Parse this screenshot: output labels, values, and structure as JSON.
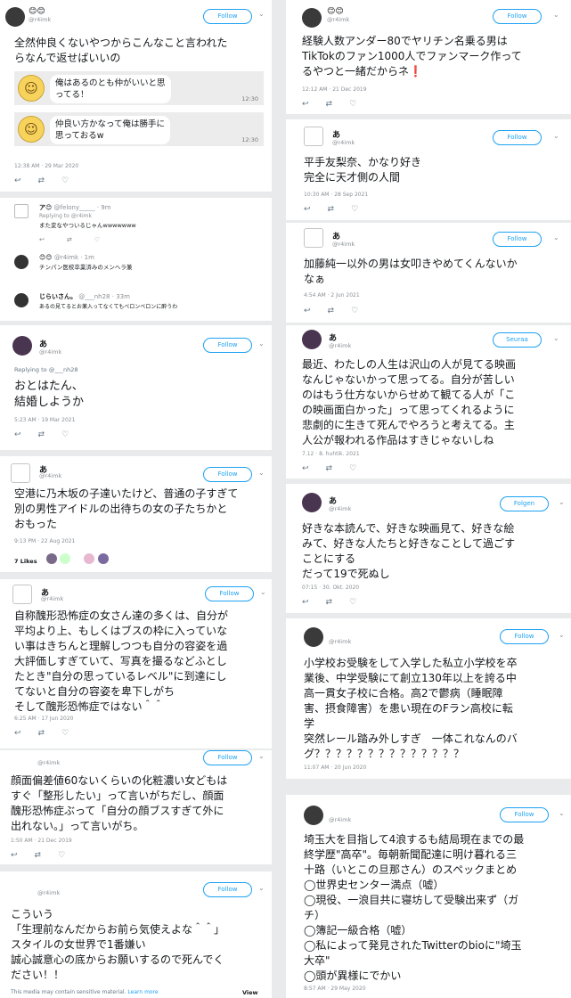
{
  "t1": {
    "emojis": "😊😊",
    "handle": "@r4imk",
    "follow": "Follow",
    "text": "全然仲良くないやつからこんなこと言われた\nらなんで返せばいいの",
    "chat1": "俺はあるのとも仲がいいと思\nってる！",
    "chat2": "仲良い方かなって俺は勝手に\n思っておるw",
    "time": "12:30",
    "ts": "12:38 AM · 29 Mar 2020"
  },
  "t2": {
    "u1": "ア😊",
    "u1handle": "@felony_____ · 9m",
    "u1reply": "Replying to @r4imk",
    "u1text": "また変なやついるじゃんwwwwwww",
    "u2": "😊😊",
    "u2handle": "@r4imk · 1m",
    "u2text": "チンパン医校卒業済みのメンヘラ兼",
    "u3": "じらいさん。",
    "u3handle": "@___nh28 · 33m",
    "u3text": "あるの見てるとお薬入ってなくてもべロンベロンに酔うわ"
  },
  "t3": {
    "name": "あ",
    "handle": "@r4imk",
    "follow": "Follow",
    "reply": "Replying to @___nh28",
    "text": "おとはたん、\n結婚しようか",
    "ts": "5:23 AM · 19 Mar 2021"
  },
  "t4": {
    "name": "あ",
    "handle": "@r4imk",
    "follow": "Follow",
    "text": "空港に乃木坂の子達いたけど、普通の子すぎて\n別の男性アイドルの出待ちの女の子たちかと\nおもった",
    "ts": "9:13 PM · 22 Aug 2021",
    "likes": "7 Likes"
  },
  "t5": {
    "name": "あ",
    "handle": "@r4imk",
    "follow": "Follow",
    "text": "自称醜形恐怖症の女さん達の多くは、自分が\n平均より上、もしくはブスの枠に入っていな\nい事はきちんと理解しつつも自分の容姿を過\n大評価しすぎていて、写真を撮るなどふとし\nたとき\"自分の思っているレベル\"に到達にし\nてないと自分の容姿を卑下しがち\nそして醜形恐怖症ではない＾＾",
    "ts": "6:25 AM · 17 Jun 2020"
  },
  "t6": {
    "handle": "@r4imk",
    "follow": "Follow",
    "text": "顔面偏差値60ないくらいの化粧濃い女どもは\nすぐ「整形したい」って言いがちだし、顔面\n醜形恐怖症ぶって「自分の顔ブスすぎて外に\n出れない。」って言いがち。",
    "ts": "1:50 AM · 21 Dec 2019"
  },
  "t7": {
    "handle": "@r4imk",
    "follow": "Follow",
    "text": "こういう\n「生理前なんだからお前ら気使えよな＾＾」\nスタイルの女世界で1番嫌い\n誠心誠意心の底からお願いするので死んでく\nださい！！",
    "sensitive": "This media may contain sensitive material.",
    "learn": "Learn more",
    "view": "View"
  },
  "t8": {
    "emojis": "😊😊",
    "handle": "@r4imk",
    "follow": "Follow",
    "text": "経験人数アンダー80でヤリチン名乗る男は\nTikTokのファン1000人でファンマーク作って\nるやつと一緒だからネ❗",
    "ts": "12:12 AM · 21 Dec 2019"
  },
  "t9": {
    "name": "あ",
    "handle": "@r4imk",
    "follow": "Follow",
    "text": "平手友梨奈、かなり好き\n完全に天才側の人間",
    "ts": "10:30 AM · 28 Sep 2021"
  },
  "t10": {
    "name": "あ",
    "handle": "@r4imk",
    "follow": "Follow",
    "text": "加藤純一以外の男は女叩きやめてくんないか\nなぁ",
    "ts": "4:54 AM · 2 Jun 2021"
  },
  "t11": {
    "name": "あ",
    "handle": "@r4imk",
    "follow": "Seuraa",
    "text": "最近、わたしの人生は沢山の人が見てる映画\nなんじゃないかって思ってる。自分が苦しい\nのはもう仕方ないからせめて観てる人が「こ\nの映画面白かった」って思ってくれるように\n悲劇的に生きて死んでやろうと考えてる。主\n人公が報われる作品はすきじゃないしね",
    "ts": "7.12 · 8. huhtik. 2021"
  },
  "t12": {
    "name": "あ",
    "handle": "@r4imk",
    "follow": "Folgen",
    "text": "好きな本読んで、好きな映画見て、好きな絵\nみて、好きな人たちと好きなことして過ごす\nことにする\nだって19で死ぬし",
    "ts": "07:15 · 30. Okt. 2020"
  },
  "t13": {
    "handle": "@r4imk",
    "follow": "Follow",
    "text": "小学校お受験をして入学した私立小学校を卒\n業後、中学受験にて創立130年以上を誇る中\n高一貫女子校に合格。高2で鬱病（睡眠障\n害、摂食障害）を患い現在のFラン高校に転\n学\n突然レール踏み外しすぎ　一体これなんのバ\nグ？？？？？？？？？？？？？？",
    "ts": "11:07 AM · 20 Jun 2020"
  },
  "t14": {
    "handle": "@r4imk",
    "follow": "Follow",
    "text": "埼玉大を目指して4浪するも結局現在までの最\n終学歴\"高卒\"。毎朝新聞配達に明け暮れる三\n十路（いとこの旦那さん）のスペックまとめ\n◯世界史センター満点（嘘）\n◯現役、一浪目共に寝坊して受験出来ず（ガ\nチ）\n◯簿記一級合格（嘘）\n◯私によって発見されたTwitterのbioに\"埼玉\n大卒\"\n◯頭が異様にでかい",
    "ts": "8:57 AM · 29 May 2020"
  },
  "icons": {
    "reply": "↩",
    "retweet": "⇄",
    "like": "♡",
    "share": "⇪",
    "chevron": "⌄"
  }
}
